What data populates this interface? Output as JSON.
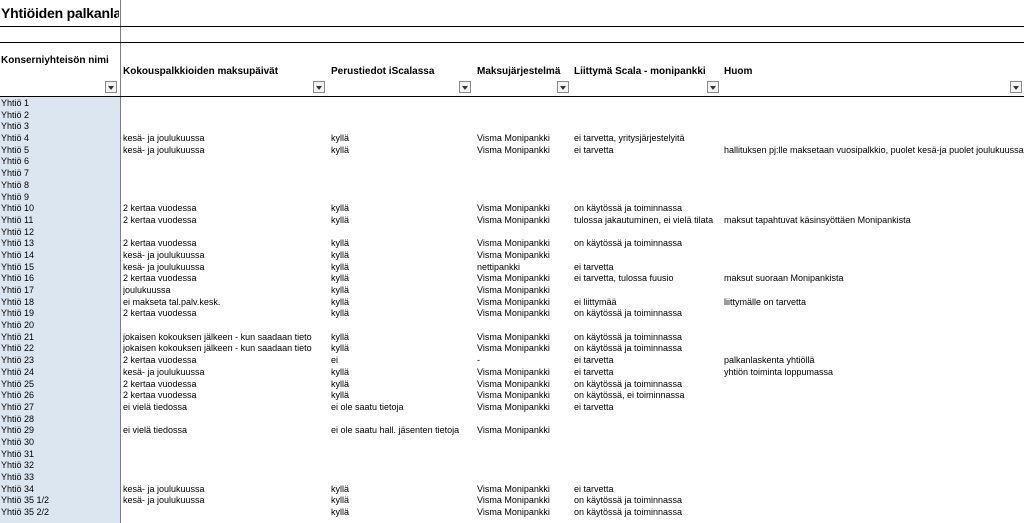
{
  "sheet": {
    "title": "Yhtiöiden palkanlaskenta",
    "frozen_column_header": "Konserniyhteisön nimi"
  },
  "columns": [
    {
      "label": "Kokouspalkkioiden maksupäivät"
    },
    {
      "label": "Perustiedot iScalassa"
    },
    {
      "label": "Maksujärjestelmä"
    },
    {
      "label": "Liittymä Scala - monipankki"
    },
    {
      "label": "Huom"
    }
  ],
  "rows": [
    {
      "name": "Yhtiö 1",
      "c1": "",
      "c2": "",
      "c3": "",
      "c4": "",
      "c5": ""
    },
    {
      "name": "Yhtiö 2",
      "c1": "",
      "c2": "",
      "c3": "",
      "c4": "",
      "c5": ""
    },
    {
      "name": "Yhtiö 3",
      "c1": "",
      "c2": "",
      "c3": "",
      "c4": "",
      "c5": ""
    },
    {
      "name": "Yhtiö 4",
      "c1": "kesä- ja joulukuussa",
      "c2": "kyllä",
      "c3": "Visma Monipankki",
      "c4": "ei tarvetta, yritysjärjestelyitä",
      "c5": ""
    },
    {
      "name": "Yhtiö 5",
      "c1": "kesä- ja joulukuussa",
      "c2": "kyllä",
      "c3": "Visma Monipankki",
      "c4": "ei tarvetta",
      "c5": "hallituksen pj:lle maksetaan vuosipalkkio, puolet kesä-ja puolet joulukuussa"
    },
    {
      "name": "Yhtiö 6",
      "c1": "",
      "c2": "",
      "c3": "",
      "c4": "",
      "c5": ""
    },
    {
      "name": "Yhtiö 7",
      "c1": "",
      "c2": "",
      "c3": "",
      "c4": "",
      "c5": ""
    },
    {
      "name": "Yhtiö 8",
      "c1": "",
      "c2": "",
      "c3": "",
      "c4": "",
      "c5": ""
    },
    {
      "name": "Yhtiö 9",
      "c1": "",
      "c2": "",
      "c3": "",
      "c4": "",
      "c5": ""
    },
    {
      "name": "Yhtiö 10",
      "c1": "2 kertaa vuodessa",
      "c2": "kyllä",
      "c3": "Visma Monipankki",
      "c4": "on käytössä ja toiminnassa",
      "c5": ""
    },
    {
      "name": "Yhtiö 11",
      "c1": "2 kertaa vuodessa",
      "c2": "kyllä",
      "c3": "Visma Monipankki",
      "c4": "tulossa jakautuminen, ei vielä tilata",
      "c5": "maksut tapahtuvat käsinsyöttäen Monipankista"
    },
    {
      "name": "Yhtiö 12",
      "c1": "",
      "c2": "",
      "c3": "",
      "c4": "",
      "c5": ""
    },
    {
      "name": "Yhtiö 13",
      "c1": "2 kertaa vuodessa",
      "c2": "kyllä",
      "c3": "Visma Monipankki",
      "c4": "on käytössä ja toiminnassa",
      "c5": ""
    },
    {
      "name": "Yhtiö 14",
      "c1": "kesä- ja joulukuussa",
      "c2": "kyllä",
      "c3": "Visma Monipankki",
      "c4": "",
      "c5": ""
    },
    {
      "name": "Yhtiö 15",
      "c1": "kesä- ja joulukuussa",
      "c2": "kyllä",
      "c3": "nettipankki",
      "c4": "ei tarvetta",
      "c5": ""
    },
    {
      "name": "Yhtiö 16",
      "c1": "2 kertaa vuodessa",
      "c2": "kyllä",
      "c3": "Visma Monipankki",
      "c4": "ei tarvetta, tulossa fuusio",
      "c5": "maksut suoraan Monipankista"
    },
    {
      "name": "Yhtiö 17",
      "c1": "joulukuussa",
      "c2": "kyllä",
      "c3": "Visma Monipankki",
      "c4": "",
      "c5": ""
    },
    {
      "name": "Yhtiö 18",
      "c1": "ei makseta tal.palv.kesk.",
      "c2": "kyllä",
      "c3": "Visma Monipankki",
      "c4": "ei liittymää",
      "c5": "liittymälle on tarvetta"
    },
    {
      "name": "Yhtiö 19",
      "c1": "2 kertaa vuodessa",
      "c2": "kyllä",
      "c3": "Visma Monipankki",
      "c4": "on käytössä ja toiminnassa",
      "c5": ""
    },
    {
      "name": "Yhtiö 20",
      "c1": "",
      "c2": "",
      "c3": "",
      "c4": "",
      "c5": ""
    },
    {
      "name": "Yhtiö 21",
      "c1": "jokaisen kokouksen jälkeen - kun saadaan tieto",
      "c2": "kyllä",
      "c3": "Visma Monipankki",
      "c4": "on käytössä ja toiminnassa",
      "c5": ""
    },
    {
      "name": "Yhtiö 22",
      "c1": "jokaisen kokouksen jälkeen - kun saadaan tieto",
      "c2": "kyllä",
      "c3": "Visma Monipankki",
      "c4": "on käytössä ja toiminnassa",
      "c5": ""
    },
    {
      "name": "Yhtiö 23",
      "c1": "2 kertaa vuodessa",
      "c2": "ei",
      "c3": "-",
      "c4": "ei tarvetta",
      "c5": "palkanlaskenta yhtiöllä"
    },
    {
      "name": "Yhtiö 24",
      "c1": "kesä- ja joulukuussa",
      "c2": "kyllä",
      "c3": "Visma Monipankki",
      "c4": "ei tarvetta",
      "c5": "yhtiön toiminta loppumassa"
    },
    {
      "name": "Yhtiö 25",
      "c1": "2 kertaa vuodessa",
      "c2": "kyllä",
      "c3": "Visma Monipankki",
      "c4": "on käytössä ja toiminnassa",
      "c5": ""
    },
    {
      "name": "Yhtiö 26",
      "c1": "2 kertaa vuodessa",
      "c2": "kyllä",
      "c3": "Visma Monipankki",
      "c4": "on käytössä, ei toiminnassa",
      "c5": ""
    },
    {
      "name": "Yhtiö 27",
      "c1": "ei vielä tiedossa",
      "c2": "ei ole saatu tietoja",
      "c3": "Visma Monipankki",
      "c4": "ei tarvetta",
      "c5": ""
    },
    {
      "name": "Yhtiö 28",
      "c1": "",
      "c2": "",
      "c3": "",
      "c4": "",
      "c5": ""
    },
    {
      "name": "Yhtiö 29",
      "c1": "ei vielä tiedossa",
      "c2": "ei ole saatu hall. jäsenten tietoja",
      "c3": "Visma Monipankki",
      "c4": "",
      "c5": ""
    },
    {
      "name": "Yhtiö 30",
      "c1": "",
      "c2": "",
      "c3": "",
      "c4": "",
      "c5": ""
    },
    {
      "name": "Yhtiö 31",
      "c1": "",
      "c2": "",
      "c3": "",
      "c4": "",
      "c5": ""
    },
    {
      "name": "Yhtiö 32",
      "c1": "",
      "c2": "",
      "c3": "",
      "c4": "",
      "c5": ""
    },
    {
      "name": "Yhtiö 33",
      "c1": "",
      "c2": "",
      "c3": "",
      "c4": "",
      "c5": ""
    },
    {
      "name": "Yhtiö 34",
      "c1": "kesä- ja joulukuussa",
      "c2": "kyllä",
      "c3": "Visma Monipankki",
      "c4": "ei tarvetta",
      "c5": ""
    },
    {
      "name": "Yhtiö 35 1/2",
      "c1": "kesä- ja joulukuussa",
      "c2": "kyllä",
      "c3": "Visma Monipankki",
      "c4": "on käytössä ja toiminnassa",
      "c5": ""
    },
    {
      "name": "Yhtiö 35 2/2",
      "c1": "",
      "c2": "kyllä",
      "c3": "Visma Monipankki",
      "c4": "on käytössä ja toiminnassa",
      "c5": ""
    }
  ]
}
